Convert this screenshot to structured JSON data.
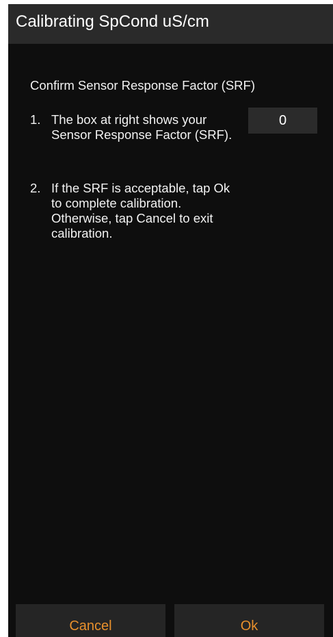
{
  "header": {
    "title": "Calibrating SpCond uS/cm"
  },
  "main": {
    "prompt": "Confirm Sensor Response Factor (SRF)",
    "steps": [
      {
        "number": "1.",
        "text": "The box at right shows your Sensor Response Factor (SRF)."
      },
      {
        "number": "2.",
        "text": "If the SRF is acceptable, tap Ok to complete calibration. Otherwise, tap Cancel to exit calibration."
      }
    ],
    "srf_value": "0"
  },
  "footer": {
    "cancel_label": "Cancel",
    "ok_label": "Ok"
  },
  "colors": {
    "background": "#0e0e0e",
    "header": "#2a2a2a",
    "accent": "#e8902c",
    "value_box": "#2b2b2b"
  }
}
